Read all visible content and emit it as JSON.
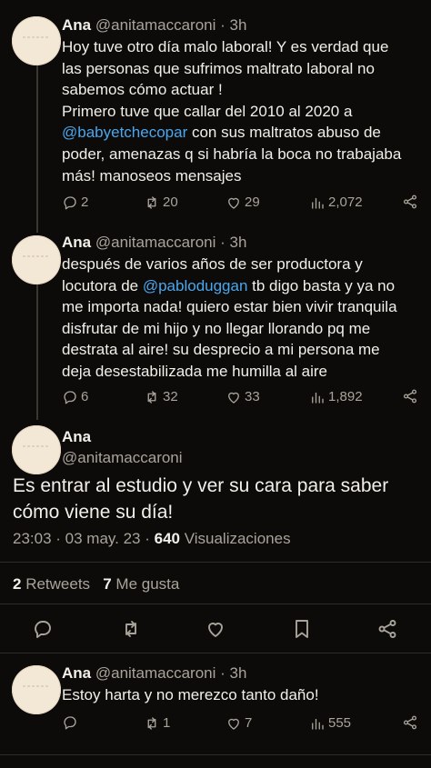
{
  "tweets": [
    {
      "name": "Ana",
      "handle": "@anitamaccaroni · 3h",
      "lines": [
        {
          "parts": [
            {
              "t": "Hoy tuve otro día malo laboral! Y es verdad que"
            }
          ]
        },
        {
          "parts": [
            {
              "t": "las personas que sufrimos maltrato laboral no"
            }
          ]
        },
        {
          "parts": [
            {
              "t": "sabemos cómo actuar !"
            }
          ]
        },
        {
          "parts": [
            {
              "t": "Primero tuve que callar del 2010 al 2020 a"
            }
          ]
        },
        {
          "parts": [
            {
              "t": "@babyetchecopar",
              "mention": true
            },
            {
              "t": " con sus maltratos abuso de"
            }
          ]
        },
        {
          "parts": [
            {
              "t": "poder, amenazas q si habría la boca no trabajaba"
            }
          ]
        },
        {
          "parts": [
            {
              "t": "más! manoseos mensajes"
            }
          ]
        }
      ],
      "replies": "2",
      "retweets": "20",
      "likes": "29",
      "views": "2,072"
    },
    {
      "name": "Ana",
      "handle": "@anitamaccaroni · 3h",
      "lines": [
        {
          "parts": [
            {
              "t": "después de varios años de ser productora y"
            }
          ]
        },
        {
          "parts": [
            {
              "t": "locutora de "
            },
            {
              "t": "@pabloduggan",
              "mention": true
            },
            {
              "t": " tb digo basta y ya no"
            }
          ]
        },
        {
          "parts": [
            {
              "t": "me importa nada! quiero estar bien vivir tranquila"
            }
          ]
        },
        {
          "parts": [
            {
              "t": "disfrutar de mi hijo y no llegar llorando pq me"
            }
          ]
        },
        {
          "parts": [
            {
              "t": "destrata al aire! su desprecio a mi persona me"
            }
          ]
        },
        {
          "parts": [
            {
              "t": "deja desestabilizada me humilla al  aire"
            }
          ]
        }
      ],
      "replies": "6",
      "retweets": "32",
      "likes": "33",
      "views": "1,892"
    }
  ],
  "main": {
    "name": "Ana",
    "handle": "@anitamaccaroni",
    "text_line1": "Es entrar al estudio y ver su cara para saber",
    "text_line2": "cómo viene su día!",
    "time": "23:03 · 03 may. 23 · ",
    "views": "640",
    "views_label": " Visualizaciones",
    "retweets": "2",
    "retweets_label": " Retweets",
    "likes": "7",
    "likes_label": " Me gusta"
  },
  "reply": {
    "name": "Ana",
    "handle": "@anitamaccaroni · 3h",
    "text": "Estoy harta y no merezco tanto daño!",
    "replies": "",
    "retweets": "1",
    "likes": "7",
    "views": "555"
  },
  "colors": {
    "background": "#0c0b09",
    "mention": "#4aa6ee",
    "secondary_text": "#a9a39a"
  }
}
